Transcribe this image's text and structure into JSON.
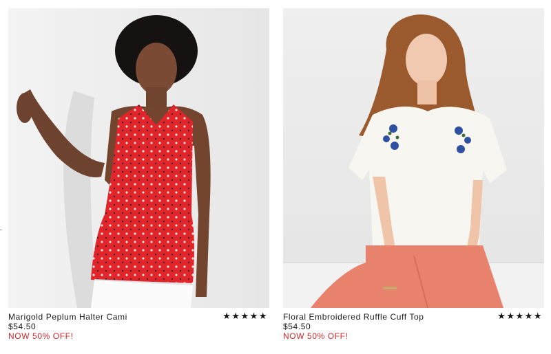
{
  "products": [
    {
      "name": "Marigold Peplum Halter Cami",
      "price": "$54.50",
      "promo": "NOW 50% OFF!",
      "rating_stars": "★★★★★",
      "rating": 5,
      "image_subject": "model in red printed peplum halter cami and white pants"
    },
    {
      "name": "Floral Embroidered Ruffle Cuff Top",
      "price": "$54.50",
      "promo": "NOW 50% OFF!",
      "rating_stars": "★★★★★",
      "rating": 5,
      "image_subject": "model in white embroidered ruffle cuff top and coral pants"
    }
  ],
  "colors": {
    "promo": "#d0282c",
    "text": "#1a1a1a"
  }
}
